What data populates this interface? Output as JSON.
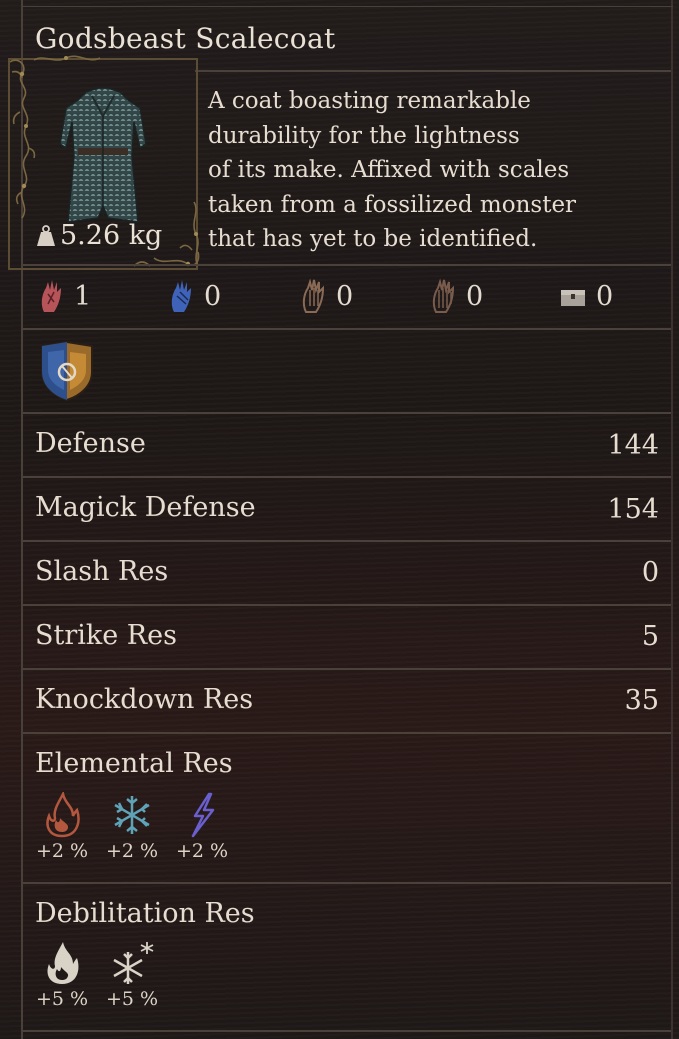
{
  "item": {
    "name": "Godsbeast Scalecoat",
    "weight": "5.26 kg",
    "description": "A coat boasting remarkable durability for the lightness of its make. Affixed with scales taken from a fossilized monster that has yet to be identified.",
    "description_lines": [
      "A coat boasting remarkable",
      "durability for the lightness",
      "of its make. Affixed with scales",
      "taken from a fossilized monster",
      "that has yet to be identified."
    ]
  },
  "rift_stones": [
    {
      "icon": "red-hand-icon",
      "value": "1",
      "color": "#b7545a"
    },
    {
      "icon": "blue-hand-icon",
      "value": "0",
      "color": "#3f63b8"
    },
    {
      "icon": "bronze-hand-icon",
      "value": "0",
      "color": "#8a6a55"
    },
    {
      "icon": "dark-hand-icon",
      "value": "0",
      "color": "#7a5c4c"
    },
    {
      "icon": "chest-icon",
      "value": "0",
      "color": "#a9a29a"
    }
  ],
  "vocation_icon": "vocation-crest-icon",
  "stats": [
    {
      "label": "Defense",
      "value": "144"
    },
    {
      "label": "Magick Defense",
      "value": "154"
    },
    {
      "label": "Slash Res",
      "value": "0"
    },
    {
      "label": "Strike Res",
      "value": "5"
    },
    {
      "label": "Knockdown Res",
      "value": "35"
    }
  ],
  "elemental": {
    "label": "Elemental Res",
    "items": [
      {
        "icon": "fire-icon",
        "value": "+2 %",
        "color": "#b3573e"
      },
      {
        "icon": "ice-icon",
        "value": "+2 %",
        "color": "#5fa3b8"
      },
      {
        "icon": "lightning-icon",
        "value": "+2 %",
        "color": "#6a5fcf"
      }
    ]
  },
  "debilitation": {
    "label": "Debilitation Res",
    "items": [
      {
        "icon": "burn-icon",
        "value": "+5 %",
        "color": "#d9d2c6"
      },
      {
        "icon": "frozen-icon",
        "value": "+5 %",
        "color": "#d9d2c6"
      }
    ]
  }
}
